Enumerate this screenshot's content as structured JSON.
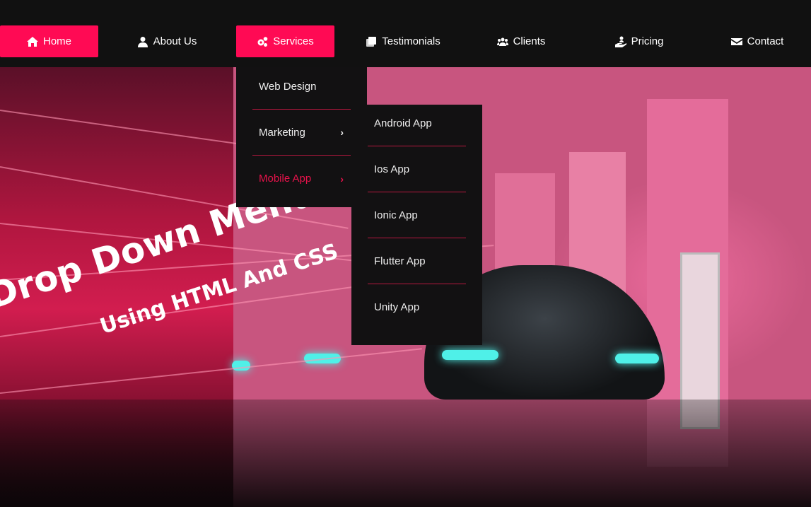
{
  "nav": {
    "items": [
      {
        "label": "Home",
        "icon": "home-icon",
        "active": true
      },
      {
        "label": "About Us",
        "icon": "user-icon",
        "active": false
      },
      {
        "label": "Services",
        "icon": "cogs-icon",
        "active": true
      },
      {
        "label": "Testimonials",
        "icon": "clone-icon",
        "active": false
      },
      {
        "label": "Clients",
        "icon": "users-icon",
        "active": false
      },
      {
        "label": "Pricing",
        "icon": "hand-holding-user-icon",
        "active": false
      },
      {
        "label": "Contact",
        "icon": "envelope-icon",
        "active": false
      }
    ]
  },
  "services_menu": {
    "items": [
      {
        "label": "Web Design"
      },
      {
        "label": "Marketing",
        "has_submenu": true
      },
      {
        "label": "Mobile App",
        "has_submenu": true,
        "highlighted": true
      }
    ]
  },
  "mobile_submenu": {
    "items": [
      {
        "label": "Android App"
      },
      {
        "label": "Ios App"
      },
      {
        "label": "Ionic App"
      },
      {
        "label": "Flutter App"
      },
      {
        "label": "Unity App"
      }
    ]
  },
  "hero": {
    "title": "Drop Down Menu",
    "subtitle": "Using HTML And CSS"
  },
  "colors": {
    "accent": "#ff0a54",
    "nav_bg": "#111111",
    "highlight": "#e8124b"
  }
}
